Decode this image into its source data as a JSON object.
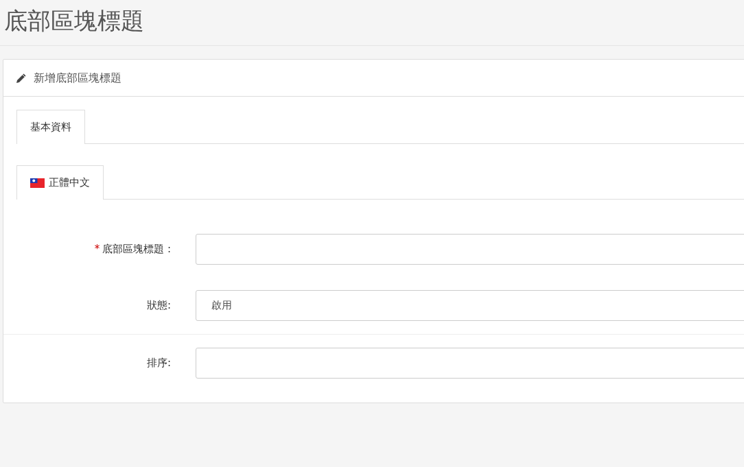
{
  "page_title": "底部區塊標題",
  "card": {
    "title": "新增底部區塊標題",
    "tabs": [
      {
        "label": "基本資料",
        "selected": true
      }
    ],
    "language_tabs": [
      {
        "label": "正體中文",
        "selected": true
      }
    ],
    "sections": [
      {
        "fields": [
          {
            "required_mark": "*",
            "label": "底部區塊標題 :"
          },
          {
            "label": "狀態:",
            "value": "啟用"
          }
        ]
      },
      {
        "fields": [
          {
            "label": "排序:"
          }
        ]
      }
    ]
  }
}
